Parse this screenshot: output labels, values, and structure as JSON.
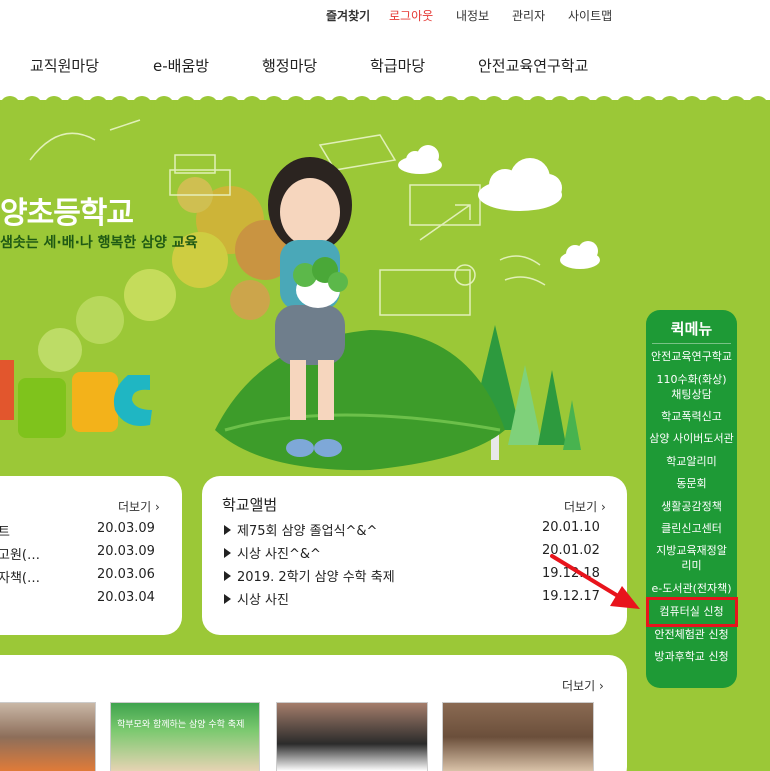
{
  "utility": {
    "favorites": "즐겨찾기",
    "logout": "로그아웃",
    "my_info": "내정보",
    "admin": "관리자",
    "sitemap": "사이트맵"
  },
  "nav": {
    "items": [
      "교직원마당",
      "e-배움방",
      "행정마당",
      "학급마당",
      "안전교육연구학교"
    ]
  },
  "hero": {
    "school_name": "양초등학교",
    "slogan": "샘솟는 세·배·나 행복한 삼양 교육"
  },
  "news": {
    "more": "더보기",
    "rows": [
      {
        "title": "트",
        "date": "20.03.09"
      },
      {
        "title": "고원(…",
        "date": "20.03.09"
      },
      {
        "title": "자책(…",
        "date": "20.03.06"
      },
      {
        "title": "",
        "date": "20.03.04"
      }
    ]
  },
  "album": {
    "title": "학교앨범",
    "more": "더보기",
    "rows": [
      {
        "title": "제75회 삼양 졸업식^&^",
        "date": "20.01.10"
      },
      {
        "title": "시상 사진^&^",
        "date": "20.01.02"
      },
      {
        "title": "2019. 2학기 삼양 수학 축제",
        "date": "19.12.18"
      },
      {
        "title": "시상 사진",
        "date": "19.12.17"
      }
    ]
  },
  "photos": {
    "more": "더보기",
    "thumb2_caption": "학부모와 함께하는 삼양 수학 축제"
  },
  "quick_menu": {
    "title": "퀵메뉴",
    "items": [
      "안전교육연구학교",
      "110수화(화상)채팅상담",
      "학교폭력신고",
      "삼양 사이버도서관",
      "학교알리미",
      "동문회",
      "생활공감정책",
      "클린신고센터",
      "지방교육재정알리미",
      "e-도서관(전자책)",
      "컴퓨터실 신청",
      "안전체험관 신청",
      "방과후학교 신청"
    ]
  },
  "colors": {
    "hero_green": "#9bc837",
    "quick_menu_green": "#1e9a36",
    "highlight_red": "#e8141c",
    "logout_red": "#e53935"
  }
}
